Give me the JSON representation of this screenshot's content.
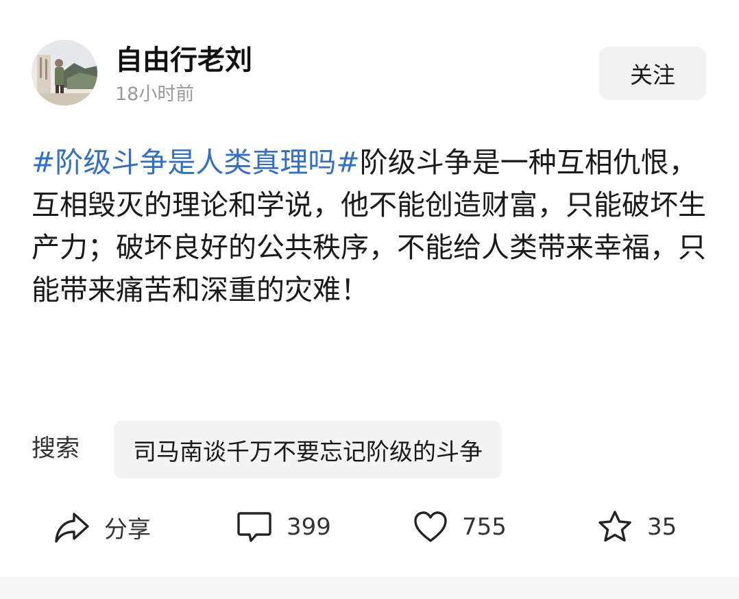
{
  "author": {
    "name": "自由行老刘",
    "time": "18小时前",
    "avatar_icon": "user-avatar-photo"
  },
  "follow_button": {
    "label": "关注"
  },
  "post": {
    "hashtag": "#阶级斗争是人类真理吗#",
    "body": "阶级斗争是一种互相仇恨，互相毁灭的理论和学说，他不能创造财富，只能破坏生产力；破坏良好的公共秩序，不能给人类带来幸福，只能带来痛苦和深重的灾难！",
    "hashtag_color": "#2f6fc6"
  },
  "search": {
    "label": "搜索",
    "suggestion": "司马南谈千万不要忘记阶级的斗争"
  },
  "actions": {
    "share": {
      "label": "分享",
      "icon": "share-arrow-icon"
    },
    "comment": {
      "count": "399",
      "icon": "comment-bubble-icon"
    },
    "like": {
      "count": "755",
      "icon": "heart-icon"
    },
    "favorite": {
      "count": "35",
      "icon": "star-icon"
    }
  }
}
